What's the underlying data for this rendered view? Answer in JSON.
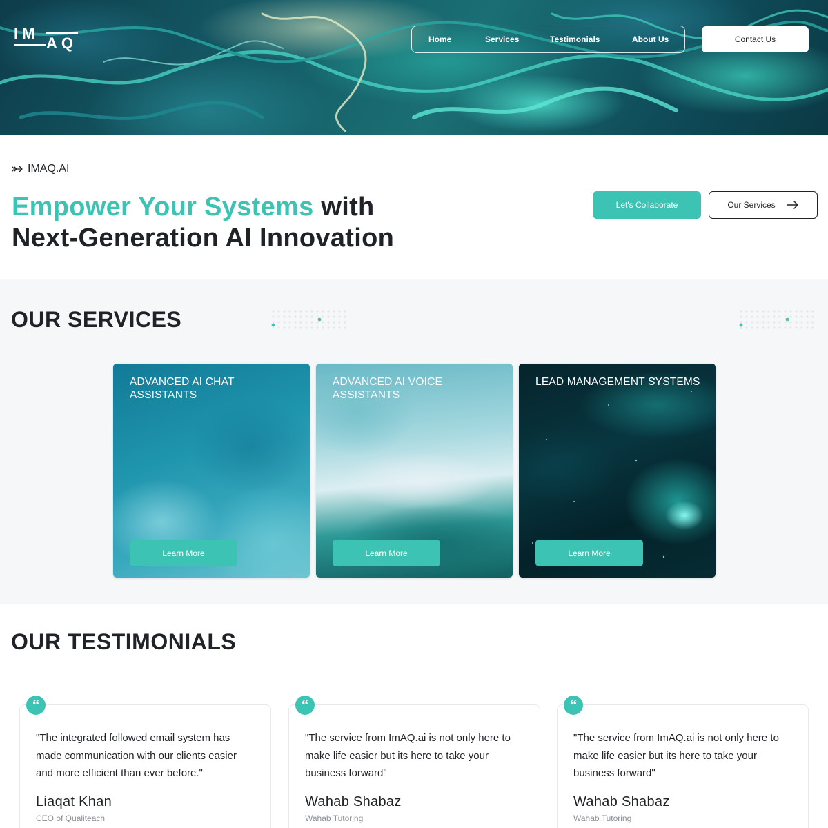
{
  "brand": {
    "logo_top": "IM",
    "logo_bottom": "AQ"
  },
  "nav": {
    "items": [
      {
        "label": "Home"
      },
      {
        "label": "Services"
      },
      {
        "label": "Testimonials"
      },
      {
        "label": "About Us"
      }
    ],
    "contact_label": "Contact Us"
  },
  "intro": {
    "crumb": "IMAQ.AI",
    "headline_accent": "Empower Your Systems",
    "headline_rest_1": " with",
    "headline_line_2": "Next-Generation AI Innovation",
    "collaborate_label": "Let's Collaborate",
    "services_label": "Our Services"
  },
  "services": {
    "title": "OUR SERVICES",
    "cards": [
      {
        "title": "ADVANCED AI CHAT ASSISTANTS",
        "button": "Learn More"
      },
      {
        "title": "ADVANCED AI VOICE ASSISTANTS",
        "button": "Learn More"
      },
      {
        "title": "LEAD MANAGEMENT SYSTEMS",
        "button": "Learn More"
      }
    ]
  },
  "testimonials": {
    "title": "OUR TESTIMONIALS",
    "items": [
      {
        "quote": "\"The integrated followed email system has made communication with our clients easier and more efficient than ever before.\"",
        "name": "Liaqat Khan",
        "role": "CEO of Qualiteach"
      },
      {
        "quote": "\"The service from ImAQ.ai is not only here to make life easier but its here to take your business forward\"",
        "name": "Wahab Shabaz",
        "role": "Wahab Tutoring"
      },
      {
        "quote": "\"The service from ImAQ.ai is not only here to make life easier but its here to take your business forward\"",
        "name": "Wahab Shabaz",
        "role": "Wahab Tutoring"
      }
    ]
  },
  "colors": {
    "accent": "#3cc3b3",
    "text": "#1f2227",
    "muted": "#8a8f96",
    "section_bg": "#f6f7f9"
  },
  "icons": {
    "crumb": "arrow-right-tail-icon",
    "services_button": "arrow-right-icon",
    "testimonial": "quote-icon"
  }
}
